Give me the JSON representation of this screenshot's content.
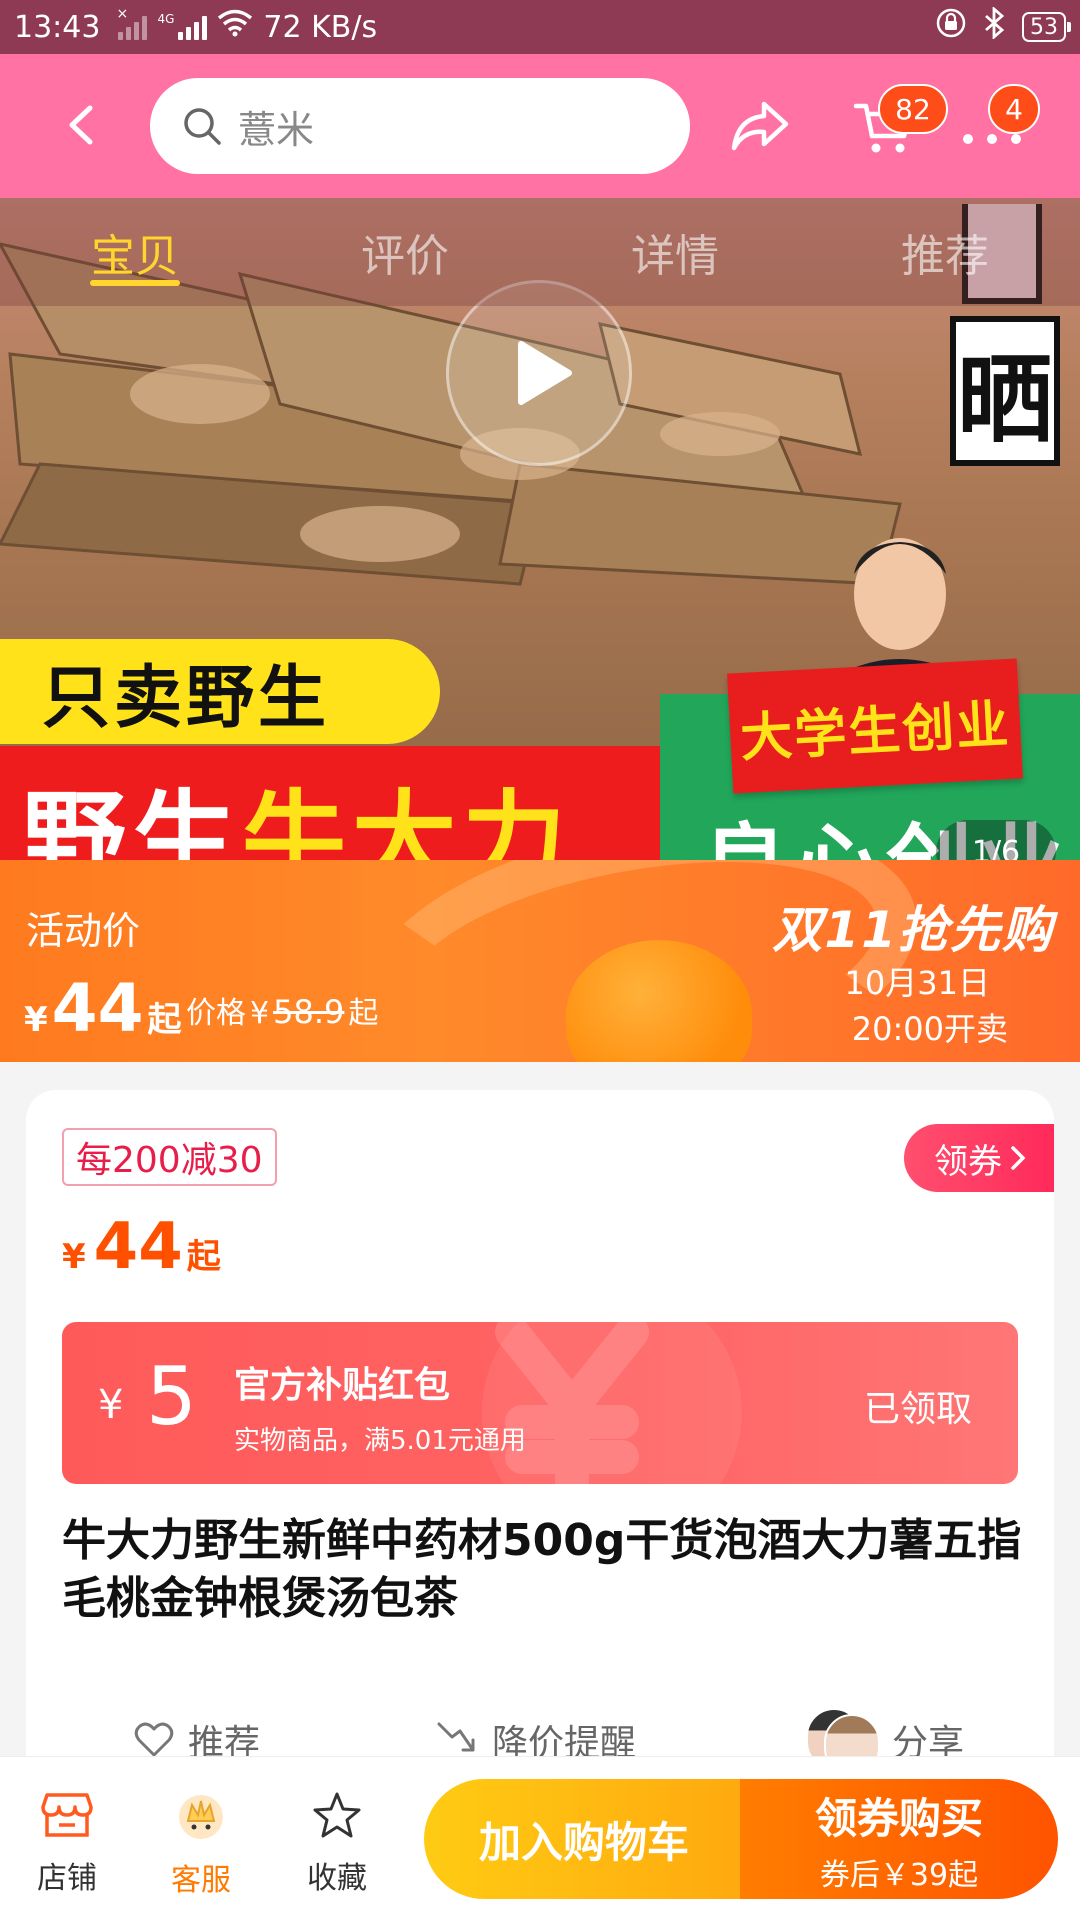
{
  "status_bar": {
    "time": "13:43",
    "network_type": "4G",
    "speed": "72 KB/s",
    "battery": "53",
    "icons": [
      "no-sim-icon",
      "signal-icon",
      "wifi-icon",
      "lock-icon",
      "bluetooth-icon",
      "battery-icon"
    ]
  },
  "header": {
    "search_placeholder": "薏米",
    "cart_badge": "82",
    "more_badge": "4",
    "icons": [
      "back-icon",
      "search-icon",
      "share-icon",
      "cart-icon",
      "more-icon"
    ]
  },
  "tabs": [
    {
      "label": "宝贝",
      "active": true
    },
    {
      "label": "评价",
      "active": false
    },
    {
      "label": "详情",
      "active": false
    },
    {
      "label": "推荐",
      "active": false
    }
  ],
  "hero": {
    "sign_text": "晒",
    "banner_yellow": "只卖野生",
    "banner_red_white": "野生",
    "banner_red_yellow": "牛大力",
    "flag_text": "大学生创业",
    "green_text": "良心创业",
    "page_indicator": "1/6"
  },
  "promo": {
    "activity_label": "活动价",
    "currency": "¥",
    "price": "44",
    "price_suffix": "起",
    "original_label": "价格",
    "original_currency": "¥",
    "original_price": "58.9",
    "original_suffix": "起",
    "event_title": "双11抢先购",
    "event_date": "10月31日",
    "event_time": "20:00开卖"
  },
  "card": {
    "coupon_tag": "每200减30",
    "claim_label": "领券",
    "currency": "¥",
    "price": "44",
    "price_suffix": "起",
    "red_packet": {
      "currency": "¥",
      "amount": "5",
      "title": "官方补贴红包",
      "subtitle": "实物商品，满5.01元通用",
      "status": "已领取"
    },
    "product_title": "牛大力野生新鲜中药材500g干货泡酒大力薯五指毛桃金钟根煲汤包茶",
    "actions": {
      "recommend": "推荐",
      "price_drop": "降价提醒",
      "share": "分享"
    }
  },
  "bottom_bar": {
    "store": "店铺",
    "service": "客服",
    "favorite": "收藏",
    "add_to_cart": "加入购物车",
    "buy_label": "领券购买",
    "buy_sub": "券后￥39起"
  },
  "colors": {
    "header_pink": "#ff72a3",
    "accent_orange": "#ff5000",
    "tab_active": "#ffd52e",
    "cart_button": "#ffb111",
    "buy_button": "#ff6400",
    "red_packet": "#ff5a5a"
  }
}
